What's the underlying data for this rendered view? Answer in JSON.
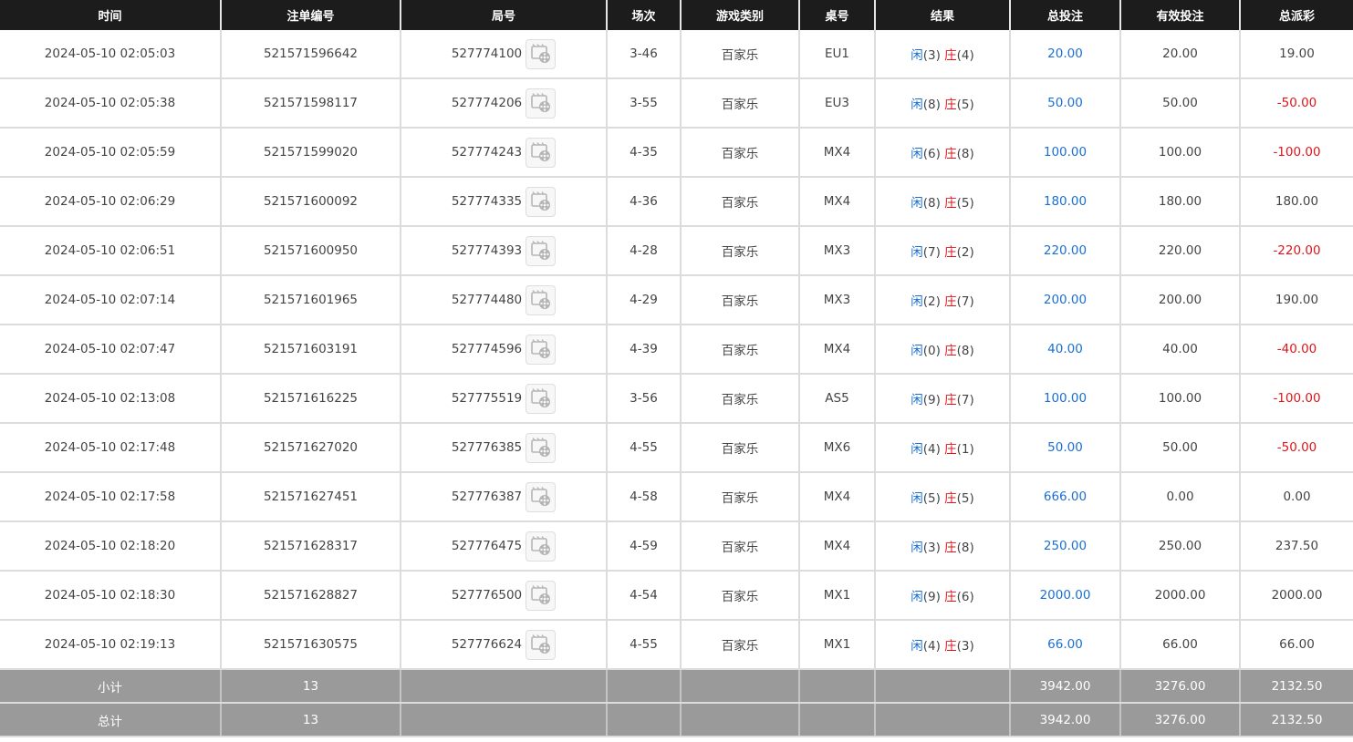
{
  "headers": [
    "时间",
    "注单编号",
    "局号",
    "场次",
    "游戏类别",
    "桌号",
    "结果",
    "总投注",
    "有效投注",
    "总派彩"
  ],
  "result_labels": {
    "player": "闲",
    "banker": "庄"
  },
  "icons": {
    "replay": "video-replay-icon"
  },
  "colors": {
    "player": "#1a6fd4",
    "banker": "#e0151a",
    "bet_total": "#1a6fd4",
    "negative": "#e0151a",
    "header_bg": "#1c1c1c",
    "summary_bg": "#9a9a9a"
  },
  "rows": [
    {
      "time": "2024-05-10 02:05:03",
      "bet_id": "521571596642",
      "round": "527774100",
      "shoe": "3-46",
      "game": "百家乐",
      "table": "EU1",
      "player_score": "(3)",
      "banker_score": "(4)",
      "total_bet": "20.00",
      "valid_bet": "20.00",
      "payout": "19.00",
      "payout_negative": false
    },
    {
      "time": "2024-05-10 02:05:38",
      "bet_id": "521571598117",
      "round": "527774206",
      "shoe": "3-55",
      "game": "百家乐",
      "table": "EU3",
      "player_score": "(8)",
      "banker_score": "(5)",
      "total_bet": "50.00",
      "valid_bet": "50.00",
      "payout": "-50.00",
      "payout_negative": true
    },
    {
      "time": "2024-05-10 02:05:59",
      "bet_id": "521571599020",
      "round": "527774243",
      "shoe": "4-35",
      "game": "百家乐",
      "table": "MX4",
      "player_score": "(6)",
      "banker_score": "(8)",
      "total_bet": "100.00",
      "valid_bet": "100.00",
      "payout": "-100.00",
      "payout_negative": true
    },
    {
      "time": "2024-05-10 02:06:29",
      "bet_id": "521571600092",
      "round": "527774335",
      "shoe": "4-36",
      "game": "百家乐",
      "table": "MX4",
      "player_score": "(8)",
      "banker_score": "(5)",
      "total_bet": "180.00",
      "valid_bet": "180.00",
      "payout": "180.00",
      "payout_negative": false
    },
    {
      "time": "2024-05-10 02:06:51",
      "bet_id": "521571600950",
      "round": "527774393",
      "shoe": "4-28",
      "game": "百家乐",
      "table": "MX3",
      "player_score": "(7)",
      "banker_score": "(2)",
      "total_bet": "220.00",
      "valid_bet": "220.00",
      "payout": "-220.00",
      "payout_negative": true
    },
    {
      "time": "2024-05-10 02:07:14",
      "bet_id": "521571601965",
      "round": "527774480",
      "shoe": "4-29",
      "game": "百家乐",
      "table": "MX3",
      "player_score": "(2)",
      "banker_score": "(7)",
      "total_bet": "200.00",
      "valid_bet": "200.00",
      "payout": "190.00",
      "payout_negative": false
    },
    {
      "time": "2024-05-10 02:07:47",
      "bet_id": "521571603191",
      "round": "527774596",
      "shoe": "4-39",
      "game": "百家乐",
      "table": "MX4",
      "player_score": "(0)",
      "banker_score": "(8)",
      "total_bet": "40.00",
      "valid_bet": "40.00",
      "payout": "-40.00",
      "payout_negative": true
    },
    {
      "time": "2024-05-10 02:13:08",
      "bet_id": "521571616225",
      "round": "527775519",
      "shoe": "3-56",
      "game": "百家乐",
      "table": "AS5",
      "player_score": "(9)",
      "banker_score": "(7)",
      "total_bet": "100.00",
      "valid_bet": "100.00",
      "payout": "-100.00",
      "payout_negative": true
    },
    {
      "time": "2024-05-10 02:17:48",
      "bet_id": "521571627020",
      "round": "527776385",
      "shoe": "4-55",
      "game": "百家乐",
      "table": "MX6",
      "player_score": "(4)",
      "banker_score": "(1)",
      "total_bet": "50.00",
      "valid_bet": "50.00",
      "payout": "-50.00",
      "payout_negative": true
    },
    {
      "time": "2024-05-10 02:17:58",
      "bet_id": "521571627451",
      "round": "527776387",
      "shoe": "4-58",
      "game": "百家乐",
      "table": "MX4",
      "player_score": "(5)",
      "banker_score": "(5)",
      "total_bet": "666.00",
      "valid_bet": "0.00",
      "payout": "0.00",
      "payout_negative": false
    },
    {
      "time": "2024-05-10 02:18:20",
      "bet_id": "521571628317",
      "round": "527776475",
      "shoe": "4-59",
      "game": "百家乐",
      "table": "MX4",
      "player_score": "(3)",
      "banker_score": "(8)",
      "total_bet": "250.00",
      "valid_bet": "250.00",
      "payout": "237.50",
      "payout_negative": false
    },
    {
      "time": "2024-05-10 02:18:30",
      "bet_id": "521571628827",
      "round": "527776500",
      "shoe": "4-54",
      "game": "百家乐",
      "table": "MX1",
      "player_score": "(9)",
      "banker_score": "(6)",
      "total_bet": "2000.00",
      "valid_bet": "2000.00",
      "payout": "2000.00",
      "payout_negative": false
    },
    {
      "time": "2024-05-10 02:19:13",
      "bet_id": "521571630575",
      "round": "527776624",
      "shoe": "4-55",
      "game": "百家乐",
      "table": "MX1",
      "player_score": "(4)",
      "banker_score": "(3)",
      "total_bet": "66.00",
      "valid_bet": "66.00",
      "payout": "66.00",
      "payout_negative": false
    }
  ],
  "summary": [
    {
      "label": "小计",
      "count": "13",
      "total_bet": "3942.00",
      "valid_bet": "3276.00",
      "payout": "2132.50"
    },
    {
      "label": "总计",
      "count": "13",
      "total_bet": "3942.00",
      "valid_bet": "3276.00",
      "payout": "2132.50"
    }
  ]
}
